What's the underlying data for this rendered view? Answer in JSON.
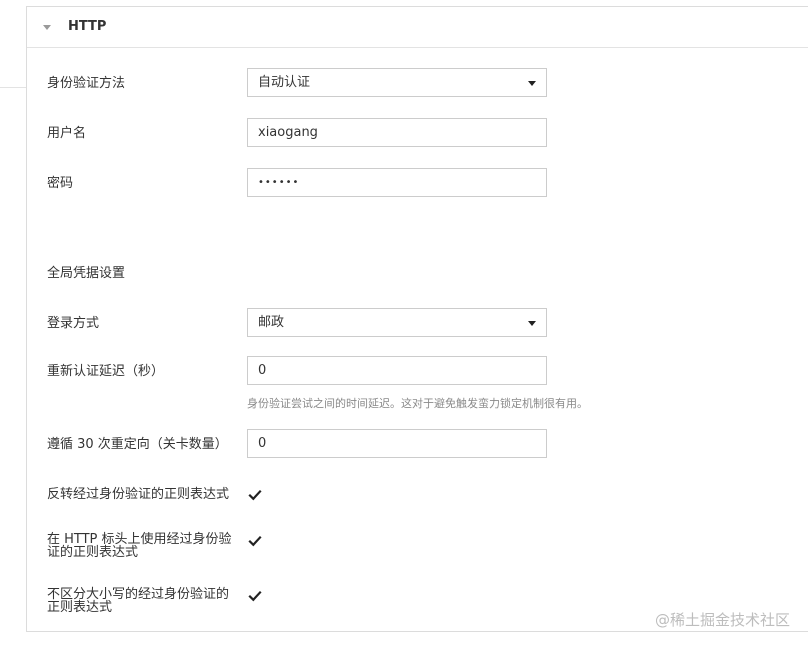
{
  "section": {
    "title": "HTTP"
  },
  "fields": {
    "auth_method": {
      "label": "身份验证方法",
      "value": "自动认证"
    },
    "username": {
      "label": "用户名",
      "value": "xiaogang"
    },
    "password": {
      "label": "密码",
      "value": "••••••"
    },
    "global_heading": "全局凭据设置",
    "login_mode": {
      "label": "登录方式",
      "value": "邮政"
    },
    "reauth_delay": {
      "label": "重新认证延迟（秒）",
      "value": "0",
      "help": "身份验证尝试之间的时间延迟。这对于避免触发蛮力锁定机制很有用。"
    },
    "redirects": {
      "label": "遵循 30 次重定向（关卡数量）",
      "value": "0"
    },
    "invert_regex": {
      "label": "反转经过身份验证的正则表达式",
      "checked": true
    },
    "header_regex": {
      "label_line1": "在 HTTP 标头上使用经过身份验",
      "label_line2": "证的正则表达式",
      "checked": true
    },
    "case_insensitive": {
      "label_line1": "不区分大小写的经过身份验证的",
      "label_line2": "正则表达式",
      "checked": true
    }
  },
  "watermark": "@稀土掘金技术社区",
  "icons": {
    "collapse": "chevron-down-icon",
    "dropdown": "caret-down-icon",
    "check": "check-icon"
  }
}
